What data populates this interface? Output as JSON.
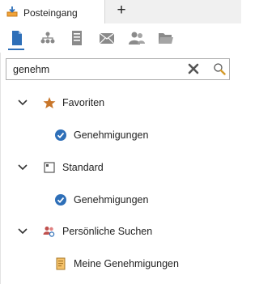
{
  "tabs": {
    "active_label": "Posteingang",
    "add_label": "+"
  },
  "toolbar": {
    "buttons": [
      {
        "name": "document-icon"
      },
      {
        "name": "org-chart-icon"
      },
      {
        "name": "list-icon"
      },
      {
        "name": "mail-icon"
      },
      {
        "name": "users-icon"
      },
      {
        "name": "folder-icon"
      }
    ],
    "accent": "#2e6fb8"
  },
  "search": {
    "value": "genehm"
  },
  "tree": {
    "groups": [
      {
        "label": "Favoriten",
        "icon": "star-icon",
        "children": [
          {
            "label": "Genehmigungen",
            "icon": "check-circle-icon"
          }
        ]
      },
      {
        "label": "Standard",
        "icon": "square-icon",
        "children": [
          {
            "label": "Genehmigungen",
            "icon": "check-circle-icon"
          }
        ]
      },
      {
        "label": "Persönliche Suchen",
        "icon": "users-search-icon",
        "children": [
          {
            "label": "Meine Genehmigungen",
            "icon": "form-icon"
          }
        ]
      }
    ]
  }
}
